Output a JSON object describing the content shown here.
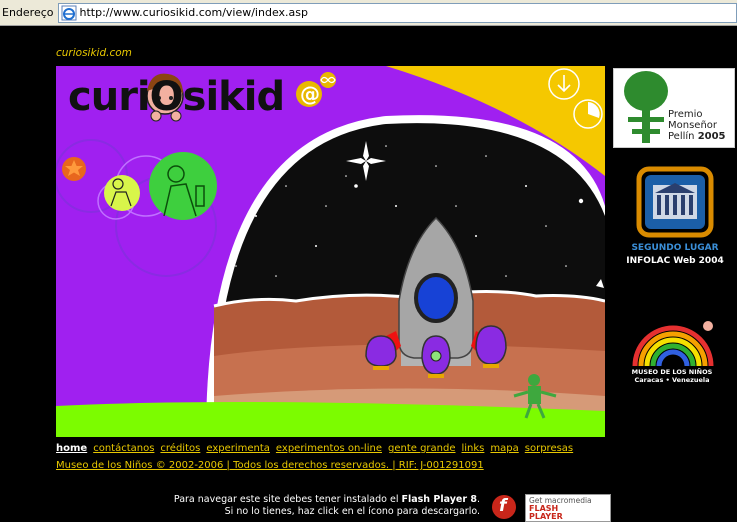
{
  "browser": {
    "address_label": "Endereço",
    "url": "http://www.curiosikid.com/view/index.asp"
  },
  "site": {
    "tagline": "curiosikid.com",
    "logo_text": "curiOsikid"
  },
  "nav": {
    "items": [
      {
        "label": "home",
        "active": true
      },
      {
        "label": "contáctanos"
      },
      {
        "label": "créditos"
      },
      {
        "label": "experimenta"
      },
      {
        "label": "experimentos on-line"
      },
      {
        "label": "gente grande"
      },
      {
        "label": "links"
      },
      {
        "label": "mapa"
      },
      {
        "label": "sorpresas"
      }
    ]
  },
  "footer": {
    "copyright": "Museo de los Niños © 2002-2006 | Todos los derechos reservados. | RIF: J-001291091",
    "flash_note_line1_prefix": "Para navegar este site debes tener instalado el ",
    "flash_note_line1_bold": "Flash Player 8",
    "flash_note_line1_suffix": ".",
    "flash_note_line2": "Si no lo tienes, haz click en el ícono para descargarlo.",
    "get_flash_line1": "Get macromedia",
    "get_flash_line2": "FLASH",
    "get_flash_line3": "PLAYER"
  },
  "awards": {
    "premio_line1": "Premio",
    "premio_line2": "Monseñor",
    "premio_line3": "Pellín",
    "premio_year": "2005",
    "infolac_line1": "SEGUNDO LUGAR",
    "infolac_line2": "INFOLAC Web  2004",
    "museo_line1": "MUSEO DE LOS NIÑOS",
    "museo_line2": "Caracas • Venezuela"
  },
  "colors": {
    "purple": "#a020f0",
    "yellow": "#f5c800",
    "link_yellow": "#e8c800",
    "green_glow": "#7cfc00"
  }
}
